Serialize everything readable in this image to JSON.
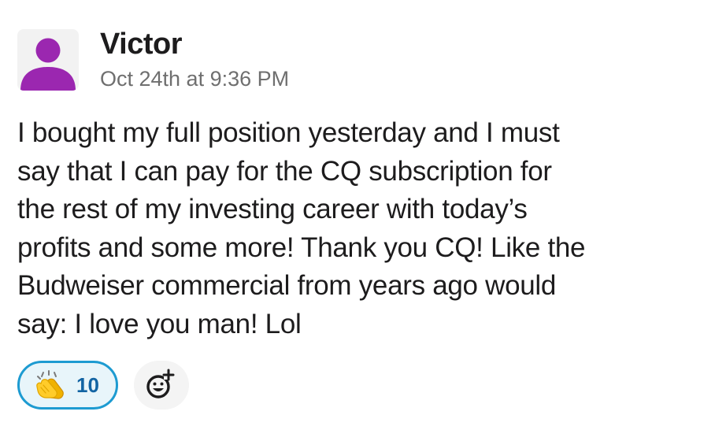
{
  "message": {
    "author": "Victor",
    "timestamp": "Oct 24th at 9:36 PM",
    "lines": [
      "I bought my full position yesterday and I must",
      "say that I can pay for the CQ subscription for",
      "the rest of my investing career with today’s",
      "profits and some more! Thank you CQ! Like the",
      "Budweiser commercial from years ago would",
      "say: I love you man! Lol"
    ]
  },
  "avatar": {
    "icon": "user-silhouette",
    "color": "#9b27b0"
  },
  "reactions": [
    {
      "icon": "clapping-hands-emoji",
      "count": "10",
      "selected": true
    }
  ],
  "add_reaction": {
    "icon": "add-emoji-icon"
  },
  "colors": {
    "text": "#1d1c1d",
    "muted": "#6f6f6f",
    "reaction_border": "#1d9bd1",
    "reaction_count": "#1264a3"
  }
}
